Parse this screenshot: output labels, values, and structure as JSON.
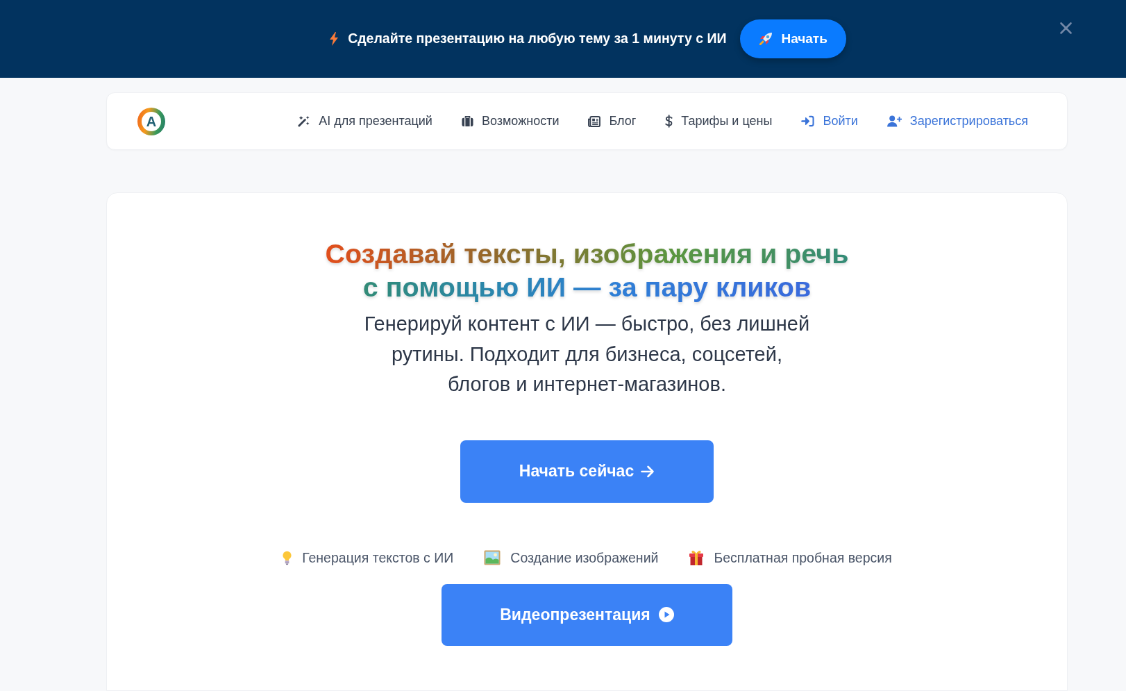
{
  "banner": {
    "text": "Сделайте презентацию на любую тему за 1 минуту с ИИ",
    "button": "Начать"
  },
  "header": {
    "logo": "A",
    "nav": [
      {
        "label": "AI для презентаций",
        "kind": "page"
      },
      {
        "label": "Возможности",
        "kind": "page"
      },
      {
        "label": "Блог",
        "kind": "page"
      },
      {
        "label": "Тарифы и цены",
        "kind": "page"
      },
      {
        "label": "Войти",
        "kind": "account"
      },
      {
        "label": "Зарегистрироваться",
        "kind": "account"
      }
    ]
  },
  "hero": {
    "title": "Создавай тексты, изображения и речь с помощью ИИ — за пару кликов",
    "subtitle": "Генерируй контент с ИИ — быстро, без лишней рутины. Подходит для бизнеса, соцсетей, блогов и интернет-магазинов.",
    "primary_button": "Начать сейчас",
    "features": [
      "Генерация текстов с ИИ",
      "Создание изображений",
      "Бесплатная пробная версия"
    ],
    "video_button": "Видеопрезентация"
  }
}
